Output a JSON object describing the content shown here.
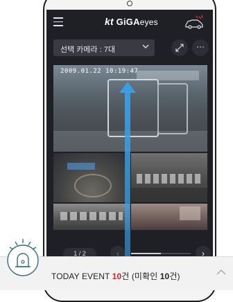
{
  "app": {
    "logo_kt": "kt",
    "logo_giga": "GiGA",
    "logo_eyes": "eyes"
  },
  "camera_select": {
    "label": "선택 카메라 : 7대"
  },
  "more_label": "···",
  "camera_tile": {
    "timestamp": "2009.01.22 10:19:47"
  },
  "pager": {
    "page": "1 / 2",
    "prev": "‹",
    "next": "›",
    "progress": 0.5
  },
  "event_bar": {
    "prefix": "TODAY EVENT ",
    "total_count": "10",
    "count_unit": "건 (미확인 ",
    "unread_count": "10",
    "suffix": "건)"
  },
  "icons": {
    "menu": "hamburger-menu-icon",
    "car": "car-alarm-icon",
    "expand": "expand-icon",
    "alarm": "siren-alarm-icon",
    "collapse": "chevron-up-icon"
  },
  "colors": {
    "accent_red": "#d8232a",
    "screen_bg": "#1f1f26",
    "arrow_blue": "#3aa0e8"
  }
}
